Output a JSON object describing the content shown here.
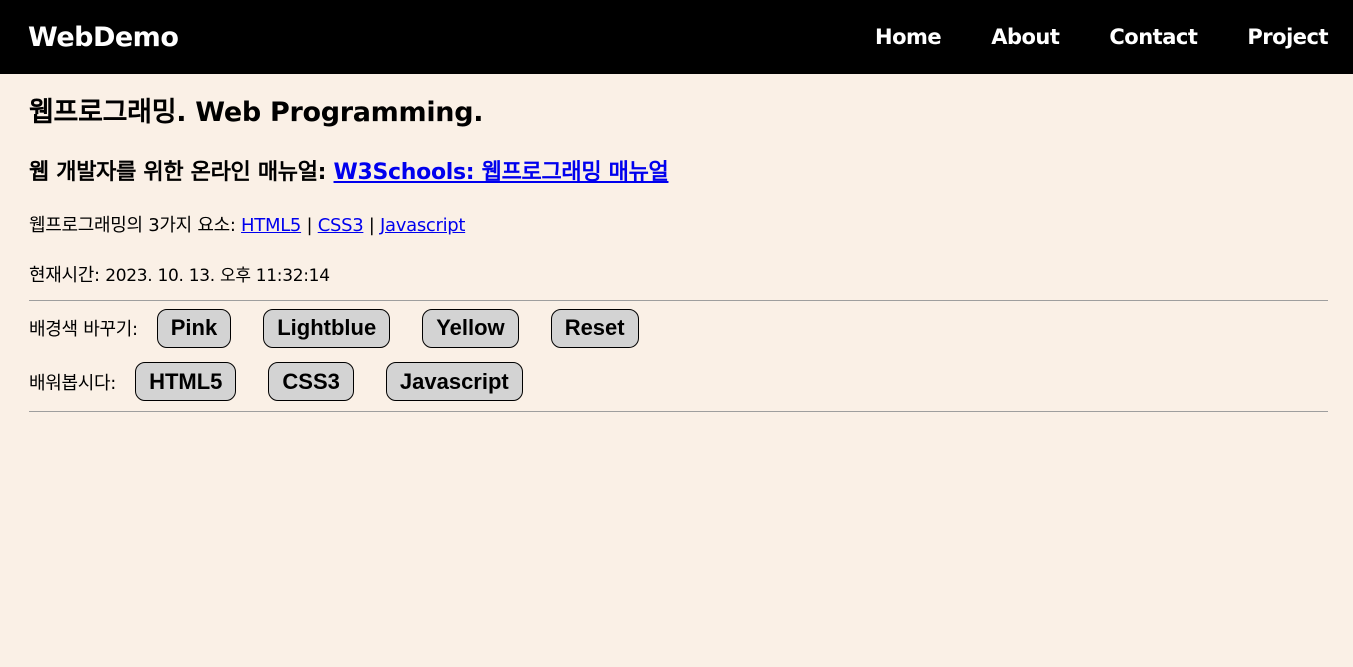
{
  "navbar": {
    "brand": "WebDemo",
    "links": [
      "Home",
      "About",
      "Contact",
      "Project"
    ]
  },
  "main": {
    "title": "웹프로그래밍. Web Programming.",
    "manual_prefix": "웹 개발자를 위한 온라인 매뉴얼: ",
    "manual_link": "W3Schools: 웹프로그래밍 매뉴얼",
    "elements_prefix": "웹프로그래밍의 3가지 요소: ",
    "element_links": [
      "HTML5",
      "CSS3",
      "Javascript"
    ],
    "separator": " | ",
    "clock_label": "현재시간: ",
    "clock_value": "2023. 10. 13. 오후 11:32:14"
  },
  "background_row": {
    "label": "배경색 바꾸기:",
    "buttons": [
      "Pink",
      "Lightblue",
      "Yellow",
      "Reset"
    ]
  },
  "learn_row": {
    "label": "배워봅시다:",
    "buttons": [
      "HTML5",
      "CSS3",
      "Javascript"
    ]
  },
  "colors": {
    "page_background": "#faf0e6",
    "navbar_background": "#000000",
    "navbar_text": "#ffffff",
    "link": "#0000ee",
    "button_background": "#d3d3d3"
  }
}
